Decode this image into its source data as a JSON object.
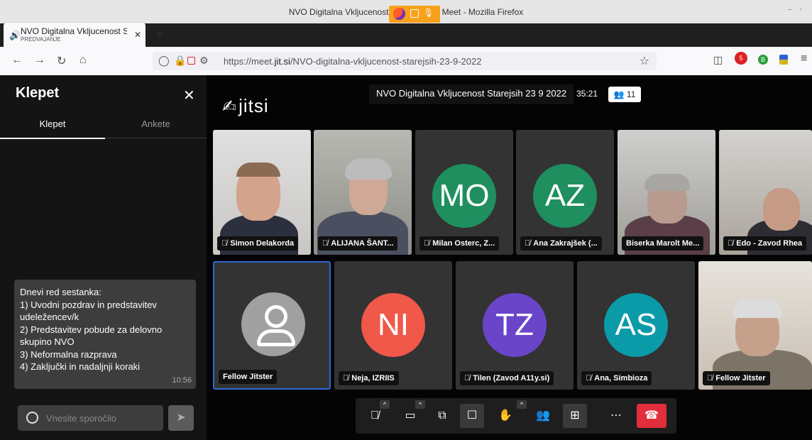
{
  "window": {
    "title": "NVO Digitalna Vkljucenost Staı 22 | Jitsi Meet - Mozilla Firefox"
  },
  "tab": {
    "title": "NVO Digitalna Vkljucenost S",
    "subtitle": "PREDVAJANJE"
  },
  "toolbar": {
    "url_prefix": "https://meet.",
    "url_domain": "jit.si",
    "url_path": "/NVO-digitalna-vkljucenost-starejsih-23-9-2022",
    "ext_badge": "5"
  },
  "chat": {
    "title": "Klepet",
    "tabs": [
      "Klepet",
      "Ankete"
    ],
    "message": {
      "lines": [
        "Dnevi red sestanka:",
        "1) Uvodni pozdrav in predstavitev",
        "udeležencev/k",
        "2) Predstavitev pobude za delovno",
        "skupino NVO",
        "3) Neformalna razprava",
        "4) Zaključki in nadaljnji koraki"
      ],
      "time": "10:56"
    },
    "input_placeholder": "Vnesite sporočilo"
  },
  "meeting": {
    "logo": "jitsi",
    "title": "NVO Digitalna Vkljucenost Starejsih 23 9 2022",
    "duration": "35:21",
    "participant_count": "11"
  },
  "tiles_row1": [
    {
      "name": "Simon Delakorda",
      "muted": true,
      "type": "video"
    },
    {
      "name": "ALIJANA ŠANT...",
      "muted": true,
      "type": "video"
    },
    {
      "name": "Milan Osterc, Z...",
      "muted": true,
      "type": "avatar",
      "initials": "MO",
      "color": "#1f8f5f"
    },
    {
      "name": "Ana Zakrajšek (...",
      "muted": true,
      "type": "avatar",
      "initials": "AZ",
      "color": "#1f8f5f"
    },
    {
      "name": "Biserka Marolt Me...",
      "muted": false,
      "type": "video"
    },
    {
      "name": "Edo - Zavod Rhea",
      "muted": true,
      "type": "video"
    }
  ],
  "tiles_row2": [
    {
      "name": "Fellow Jitster",
      "muted": false,
      "type": "avatar",
      "initials": "",
      "color": "#a0a0a0"
    },
    {
      "name": "Neja, IZRIIS",
      "muted": true,
      "type": "avatar",
      "initials": "NI",
      "color": "#f0584a"
    },
    {
      "name": "Tilen (Zavod A11y.si)",
      "muted": true,
      "type": "avatar",
      "initials": "TZ",
      "color": "#6a45c9"
    },
    {
      "name": "Ana, Simbioza",
      "muted": true,
      "type": "avatar",
      "initials": "AS",
      "color": "#0b9aa8"
    },
    {
      "name": "Fellow Jitster",
      "muted": true,
      "type": "video"
    }
  ],
  "controls": [
    "mic-muted-icon",
    "camera-icon",
    "screenshare-icon",
    "chat-icon",
    "raise-hand-icon",
    "participants-icon",
    "tile-view-icon",
    "more-icon",
    "hangup-icon"
  ]
}
